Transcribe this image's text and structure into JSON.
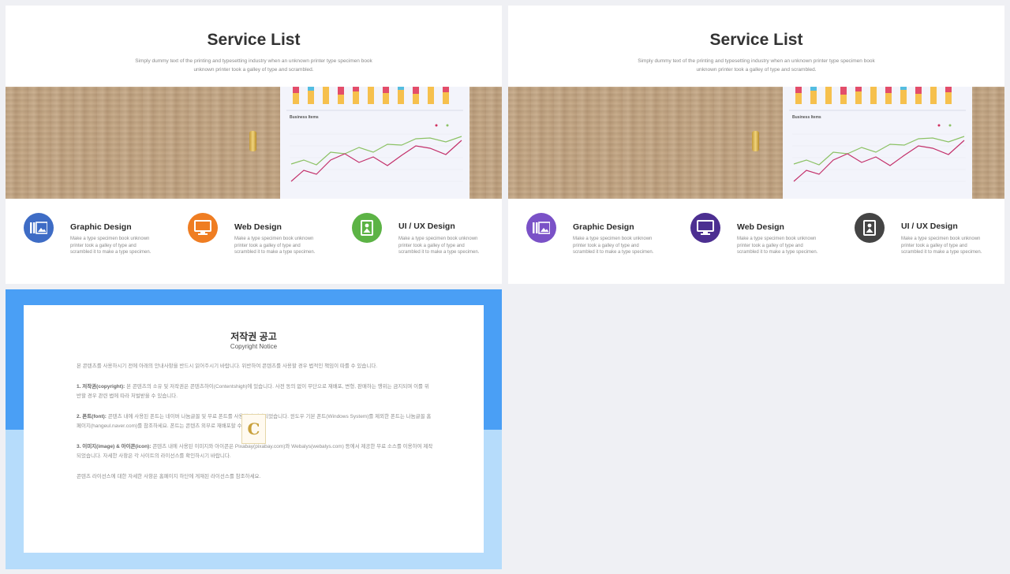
{
  "slides": [
    {
      "title": "Service List",
      "subtitle": "Simply dummy text of the printing and typesetting industry when an unknown printer type specimen book unknown printer took a galley of type and scrambled.",
      "chart_card_title": "Business Items",
      "services": [
        {
          "name": "Graphic Design",
          "description": "Make a type specimen book unknown printer took a galley of type and scrambled it to make a type specimen.",
          "color": "#3e6cc5",
          "icon": "gallery-icon"
        },
        {
          "name": "Web Design",
          "description": "Make a type specimen book unknown printer took a galley of type and scrambled it to make a type specimen.",
          "color": "#ef7d22",
          "icon": "monitor-icon"
        },
        {
          "name": "UI / UX Design",
          "description": "Make a type specimen book unknown printer took a galley of type and scrambled it to make a type specimen.",
          "color": "#5cb345",
          "icon": "image-icon"
        }
      ]
    },
    {
      "title": "Service List",
      "subtitle": "Simply dummy text of the printing and typesetting industry when an unknown printer type specimen book unknown printer took a galley of type and scrambled.",
      "chart_card_title": "Business Items",
      "services": [
        {
          "name": "Graphic Design",
          "description": "Make a type specimen book unknown printer took a galley of type and scrambled it to make a type specimen.",
          "color": "#7a51c7",
          "icon": "gallery-icon"
        },
        {
          "name": "Web Design",
          "description": "Make a type specimen book unknown printer took a galley of type and scrambled it to make a type specimen.",
          "color": "#4c2f91",
          "icon": "monitor-icon"
        },
        {
          "name": "UI / UX Design",
          "description": "Make a type specimen book unknown printer took a galley of type and scrambled it to make a type specimen.",
          "color": "#444444",
          "icon": "image-icon"
        }
      ]
    }
  ],
  "notice": {
    "title": "저작권 공고",
    "subtitle": "Copyright Notice",
    "intro": "본 콘텐츠를 사용하시기 전에 아래의 안내사항을 반드시 읽어주시기 바랍니다. 위반하여 콘텐츠를 사용할 경우 법적인 책임이 따를 수 있습니다.",
    "sections": [
      {
        "heading": "1. 저작권(copyright):",
        "text": "본 콘텐츠의 소유 및 저작권은 콘텐츠하이(Contentshigh)에 있습니다. 사전 동의 없이 무단으로 재배포, 변형, 판매하는 행위는 금지되며 이를 위반할 경우 관련 법에 따라 처벌받을 수 있습니다."
      },
      {
        "heading": "2. 폰트(font):",
        "text": "콘텐츠 내에 사용된 폰트는 네이버 나눔글꼴 및 무료 폰트를 사용하여 제작되었습니다. 윈도우 기본 폰트(Windows System)를 제외한 폰트는 나눔글꼴 홈페이지(hangeul.naver.com)를 참조하세요. 폰트는 콘텐츠 외부로 재배포할 수 없습니다."
      },
      {
        "heading": "3. 이미지(image) & 아이콘(icon):",
        "text": "콘텐츠 내에 사용된 이미지와 아이콘은 Pixabay(pixabay.com)와 Webalys(webalys.com) 등에서 제공한 무료 소스를 이용하여 제작되었습니다. 자세한 사항은 각 사이트의 라이선스를 확인하시기 바랍니다."
      }
    ],
    "outro": "콘텐츠 라이선스에 대한 자세한 사항은 홈페이지 하단에 게재된 라이선스를 참조하세요.",
    "logo_letter": "C"
  }
}
